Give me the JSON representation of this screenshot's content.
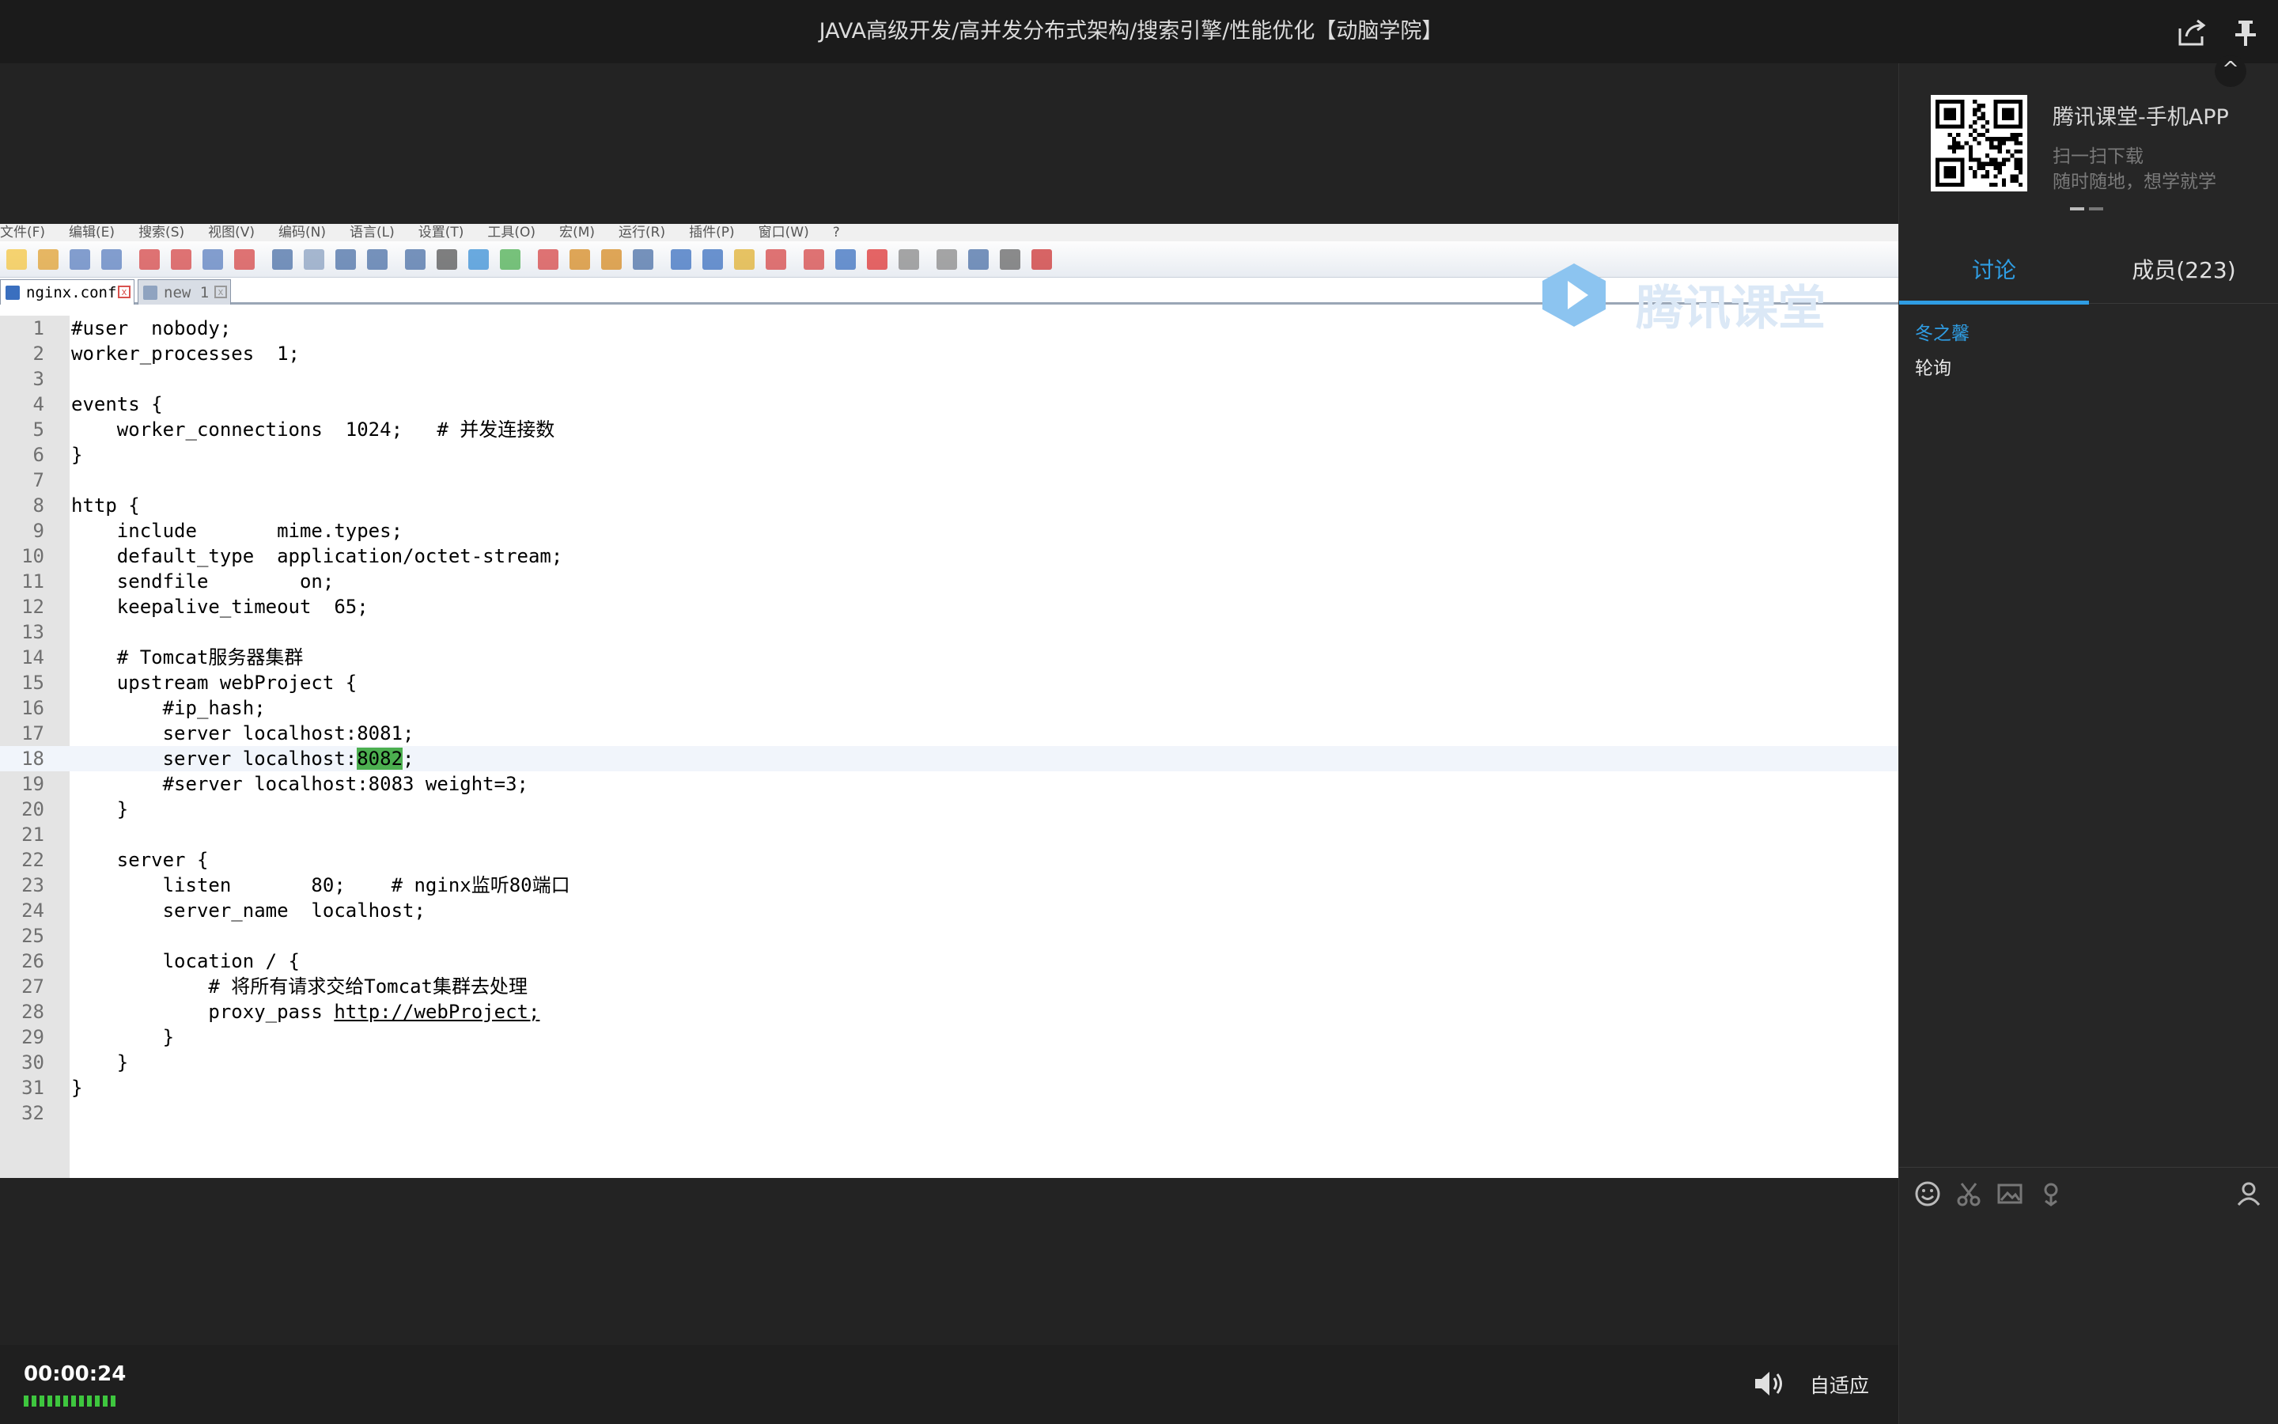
{
  "window": {
    "title": "JAVA高级开发/高并发分布式架构/搜索引擎/性能优化【动脑学院】"
  },
  "editor": {
    "menu": [
      "文件(F)",
      "编辑(E)",
      "搜索(S)",
      "视图(V)",
      "编码(N)",
      "语言(L)",
      "设置(T)",
      "工具(O)",
      "宏(M)",
      "运行(R)",
      "插件(P)",
      "窗口(W)",
      "?"
    ],
    "tabs": [
      {
        "label": "nginx.conf"
      },
      {
        "label": "new 1"
      }
    ],
    "watermark": "腾讯课堂",
    "lines": [
      {
        "n": "1",
        "text": "#user  nobody;"
      },
      {
        "n": "2",
        "text": "worker_processes  1;"
      },
      {
        "n": "3",
        "text": ""
      },
      {
        "n": "4",
        "text": "events {"
      },
      {
        "n": "5",
        "text": "    worker_connections  1024;   # 并发连接数"
      },
      {
        "n": "6",
        "text": "}"
      },
      {
        "n": "7",
        "text": ""
      },
      {
        "n": "8",
        "text": "http {"
      },
      {
        "n": "9",
        "text": "    include       mime.types;"
      },
      {
        "n": "10",
        "text": "    default_type  application/octet-stream;"
      },
      {
        "n": "11",
        "text": "    sendfile        on;"
      },
      {
        "n": "12",
        "text": "    keepalive_timeout  65;"
      },
      {
        "n": "13",
        "text": ""
      },
      {
        "n": "14",
        "text": "    # Tomcat服务器集群"
      },
      {
        "n": "15",
        "text": "    upstream webProject {"
      },
      {
        "n": "16",
        "text": "        #ip_hash;"
      },
      {
        "n": "17",
        "text": "        server localhost:8081;"
      },
      {
        "n": "18",
        "pre": "        server localhost:",
        "hl": "8082",
        "post": ";"
      },
      {
        "n": "19",
        "text": "        #server localhost:8083 weight=3;"
      },
      {
        "n": "20",
        "text": "    }"
      },
      {
        "n": "21",
        "text": ""
      },
      {
        "n": "22",
        "text": "    server {"
      },
      {
        "n": "23",
        "text": "        listen       80;    # nginx监听80端口"
      },
      {
        "n": "24",
        "text": "        server_name  localhost;"
      },
      {
        "n": "25",
        "text": ""
      },
      {
        "n": "26",
        "text": "        location / {"
      },
      {
        "n": "27",
        "text": "            # 将所有请求交给Tomcat集群去处理"
      },
      {
        "n": "28",
        "pre": "            proxy_pass ",
        "link": "http://webProject;"
      },
      {
        "n": "29",
        "text": "        }"
      },
      {
        "n": "30",
        "text": "    }"
      },
      {
        "n": "31",
        "text": "}"
      },
      {
        "n": "32",
        "text": ""
      }
    ]
  },
  "player": {
    "time": "00:00:24",
    "fit_label": "自适应",
    "volume_icon": "speaker-icon"
  },
  "sidebar": {
    "app_name": "腾讯课堂-手机APP",
    "app_sub1": "扫一扫下载",
    "app_sub2": "随时随地，想学就学",
    "tab_discuss": "讨论",
    "tab_members": "成员(223)",
    "messages": [
      {
        "user": "冬之馨",
        "text": "轮询"
      }
    ]
  },
  "colors": {
    "accent": "#2f9de3",
    "highlight": "#4caf50",
    "progress": "#3ec63e"
  }
}
